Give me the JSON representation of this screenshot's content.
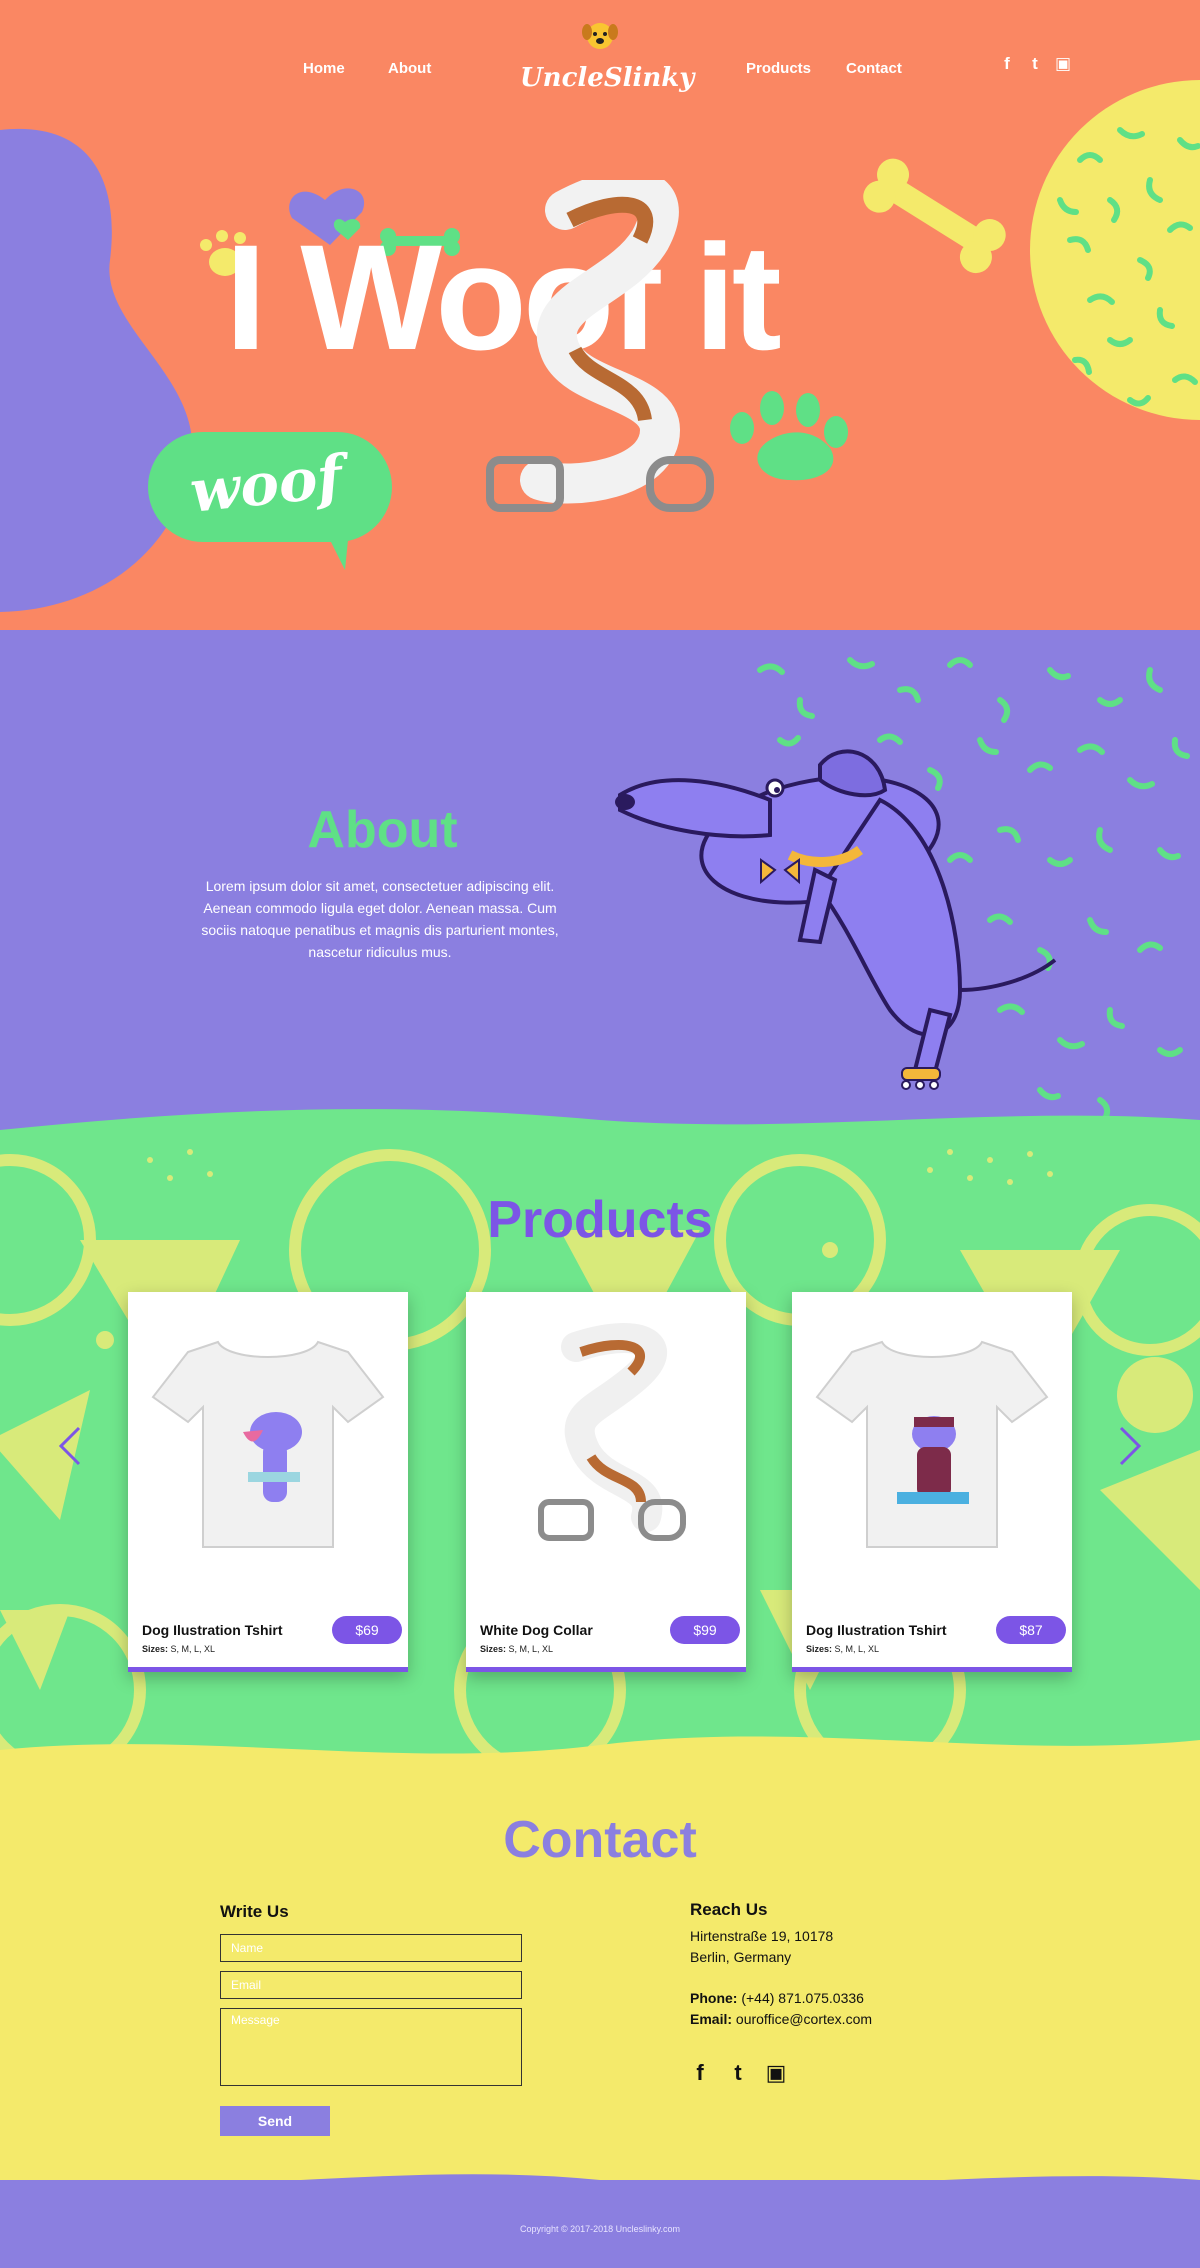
{
  "nav": {
    "links": [
      "Home",
      "About",
      "Products",
      "Contact"
    ],
    "logo": "UncleSlinky",
    "social": [
      "facebook-icon",
      "twitter-icon",
      "instagram-icon"
    ]
  },
  "hero": {
    "title": "I Woof it",
    "bubble": "woof"
  },
  "about": {
    "title": "About",
    "text": "Lorem ipsum dolor sit amet, consectetuer adipiscing elit. Aenean commodo ligula eget dolor. Aenean massa. Cum sociis natoque penatibus et magnis dis parturient montes, nascetur ridiculus mus."
  },
  "products": {
    "title": "Products",
    "items": [
      {
        "name": "Dog Ilustration Tshirt",
        "sizes_label": "Sizes:",
        "sizes": "S, M, L, XL",
        "price": "$69"
      },
      {
        "name": "White Dog Collar",
        "sizes_label": "Sizes:",
        "sizes": "S, M, L, XL",
        "price": "$99"
      },
      {
        "name": "Dog Ilustration Tshirt",
        "sizes_label": "Sizes:",
        "sizes": "S, M, L, XL",
        "price": "$87"
      }
    ]
  },
  "contact": {
    "title": "Contact",
    "write_heading": "Write Us",
    "name_placeholder": "Name",
    "email_placeholder": "Email",
    "message_placeholder": "Message",
    "send_label": "Send",
    "reach_heading": "Reach Us",
    "address_line1": "Hirtenstraße 19, 10178",
    "address_line2": "Berlin, Germany",
    "phone_label": "Phone:",
    "phone": "(+44) 871.075.0336",
    "email_label": "Email:",
    "email": "ouroffice@cortex.com"
  },
  "footer": {
    "copyright": "Copyright © 2017-2018 Uncleslinky.com"
  },
  "colors": {
    "coral": "#fa8763",
    "purple": "#8b7fe0",
    "violet": "#7c55e6",
    "green": "#5fe086",
    "yellow": "#f4ea6b"
  }
}
